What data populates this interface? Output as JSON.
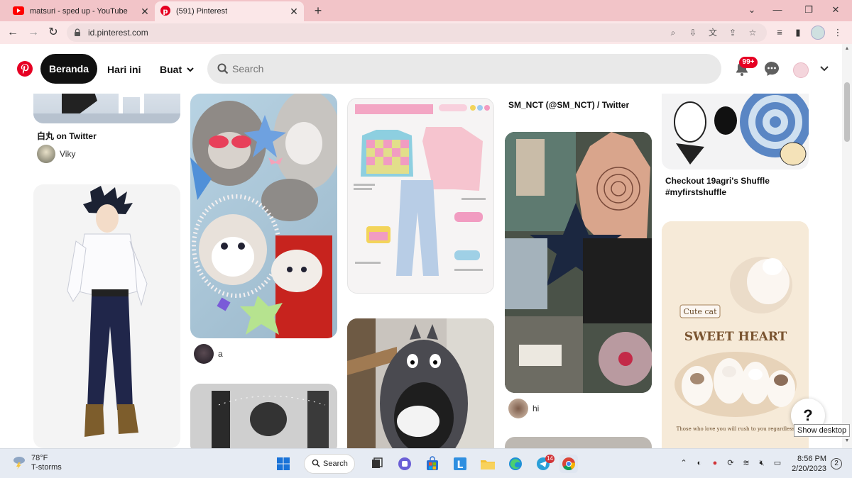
{
  "browser": {
    "tabs": [
      {
        "title": "matsuri - sped up - YouTube",
        "icon": "youtube-icon",
        "color": "#ff0000"
      },
      {
        "title": "(591) Pinterest",
        "icon": "pinterest-icon",
        "color": "#e60023"
      }
    ],
    "url": "id.pinterest.com"
  },
  "header": {
    "home_label": "Beranda",
    "today_label": "Hari ini",
    "create_label": "Buat",
    "search_placeholder": "Search",
    "notification_count": "99+",
    "accent": "#e60023"
  },
  "feed": {
    "col1": [
      {
        "title": "白丸 on Twitter",
        "user": "Viky"
      }
    ],
    "col2": [
      {
        "user": "a"
      }
    ],
    "col3": [],
    "col4": [
      {
        "title": "SM_NCT (@SM_NCT) / Twitter"
      },
      {
        "user": "hi"
      }
    ],
    "col5": [
      {
        "title": "Checkout 19agri's Shuffle #myfirstshuffle"
      }
    ]
  },
  "help": {
    "label": "?",
    "tooltip": "Show desktop"
  },
  "taskbar": {
    "temp": "78°F",
    "condition": "T-storms",
    "search_label": "Search",
    "time": "8:56 PM",
    "date": "2/20/2023",
    "notif_count": "2",
    "app_badge": "14"
  }
}
